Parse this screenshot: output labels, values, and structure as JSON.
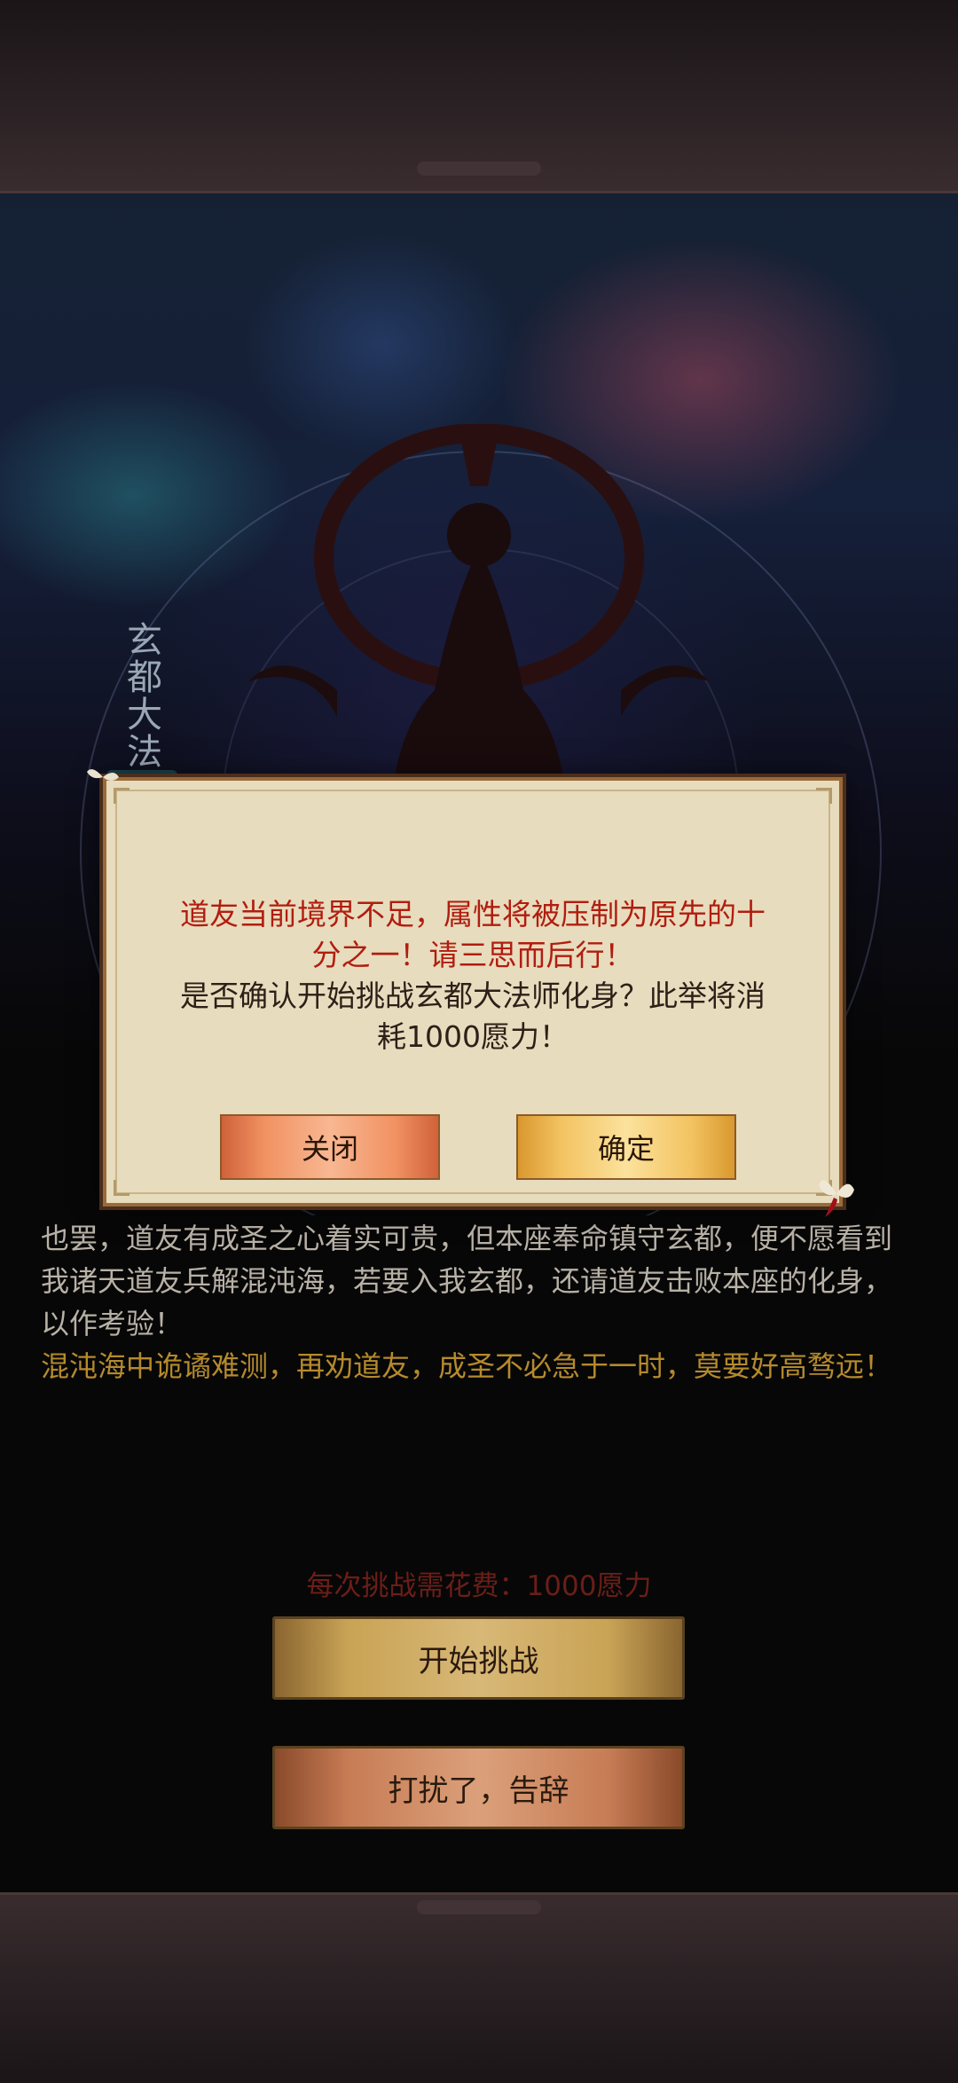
{
  "story": {
    "line1": "也罢，道友有成圣之心着实可贵，但本座奉命镇守玄都，便不愿看到",
    "line2": "我诸天道友兵解混沌海，若要入我玄都，还请道友击败本座的化身，",
    "line3": "以作考验！",
    "line4": "混沌海中诡谲难测，再劝道友，成圣不必急于一时，莫要好高骛远！"
  },
  "boss_name": "玄都大法",
  "cost_text": "每次挑战需花费：1000愿力",
  "buttons": {
    "start": "开始挑战",
    "leave": "打扰了，告辞"
  },
  "dialog": {
    "warning_line1": "道友当前境界不足，属性将被压制为原先的十",
    "warning_line2": "分之一！请三思而后行！",
    "confirm_line1": "是否确认开始挑战玄都大法师化身？此举将消",
    "confirm_line2": "耗1000愿力！",
    "close_label": "关闭",
    "ok_label": "确定"
  }
}
